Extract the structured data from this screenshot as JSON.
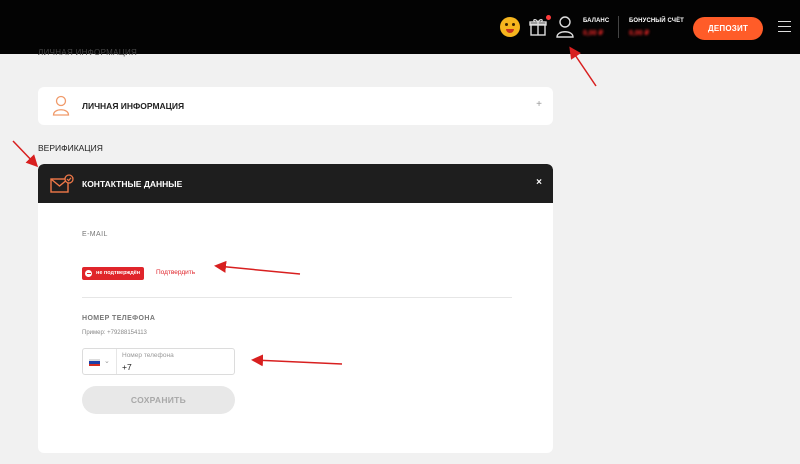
{
  "header": {
    "balance_label": "БАЛАНС",
    "balance_value": "0,00 ₽",
    "bonus_label": "БОНУСНЫЙ СЧЁТ",
    "bonus_value": "0,00 ₽",
    "deposit_label": "ДЕПОЗИТ"
  },
  "page": {
    "cut_heading": "ЛИЧНАЯ ИНФОРМАЦИЯ"
  },
  "personal_card": {
    "title": "ЛИЧНАЯ ИНФОРМАЦИЯ",
    "toggle": "+"
  },
  "verification": {
    "section_title": "ВЕРИФИКАЦИЯ",
    "card_title": "КОНТАКТНЫЕ ДАННЫЕ",
    "close": "×",
    "email_label": "E-MAIL",
    "email_status": "не подтверждён",
    "confirm_link": "Подтвердить",
    "phone_label": "НОМЕР ТЕЛЕФОНА",
    "phone_example": "Пример: +79288154113",
    "phone_placeholder": "Номер телефона",
    "phone_value": "+7",
    "save_button": "СОХРАНИТЬ"
  },
  "colors": {
    "accent": "#ff5c28",
    "status_red": "#e0252b",
    "header_bg": "#030303",
    "card_head_bg": "#1e1e1e",
    "annotation_arrow": "#d81f1f"
  },
  "icons": [
    "emoji-icon",
    "gift-icon",
    "user-icon",
    "menu-icon",
    "avatar-icon",
    "mail-icon",
    "flag-ru-icon",
    "chevron-down-icon"
  ]
}
